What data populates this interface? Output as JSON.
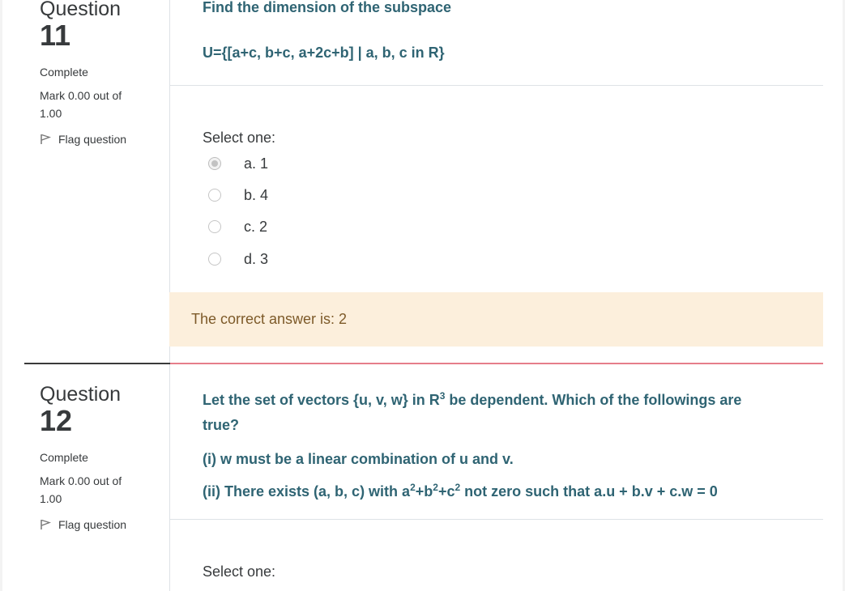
{
  "questions": [
    {
      "question_word": "Question",
      "number": "11",
      "state": "Complete",
      "grade": "Mark 0.00 out of 1.00",
      "flag_label": "Flag question",
      "text_line1": "Find the dimension of the subspace",
      "text_line2": "U={[a+c, b+c, a+2c+b] | a, b, c in R}",
      "select_label": "Select one:",
      "options": [
        {
          "label": "a. 1",
          "selected": true
        },
        {
          "label": "b. 4",
          "selected": false
        },
        {
          "label": "c. 2",
          "selected": false
        },
        {
          "label": "d. 3",
          "selected": false
        }
      ],
      "feedback": "The correct answer is: 2"
    },
    {
      "question_word": "Question",
      "number": "12",
      "state": "Complete",
      "grade": "Mark 0.00 out of 1.00",
      "flag_label": "Flag question",
      "text_line1_pre": "Let the set of vectors {u, v, w} in R",
      "text_line1_sup": "3",
      "text_line1_post": " be dependent. Which of the followings are",
      "text_line1_wrap": "true?",
      "text_line2": "(i) w must be a linear combination of u and v.",
      "text_line3_a": "(ii) There exists (a, b, c) with a",
      "text_line3_sup1": "2",
      "text_line3_b": "+b",
      "text_line3_sup2": "2",
      "text_line3_c": "+c",
      "text_line3_sup3": "2",
      "text_line3_d": " not zero such that a.u + b.v + c.w = 0",
      "select_label": "Select one:"
    }
  ],
  "colors": {
    "question_text": "#2f6473",
    "feedback_bg": "#fcefdc",
    "feedback_text": "#7d5a29",
    "separator_active": "#e67e8a"
  }
}
